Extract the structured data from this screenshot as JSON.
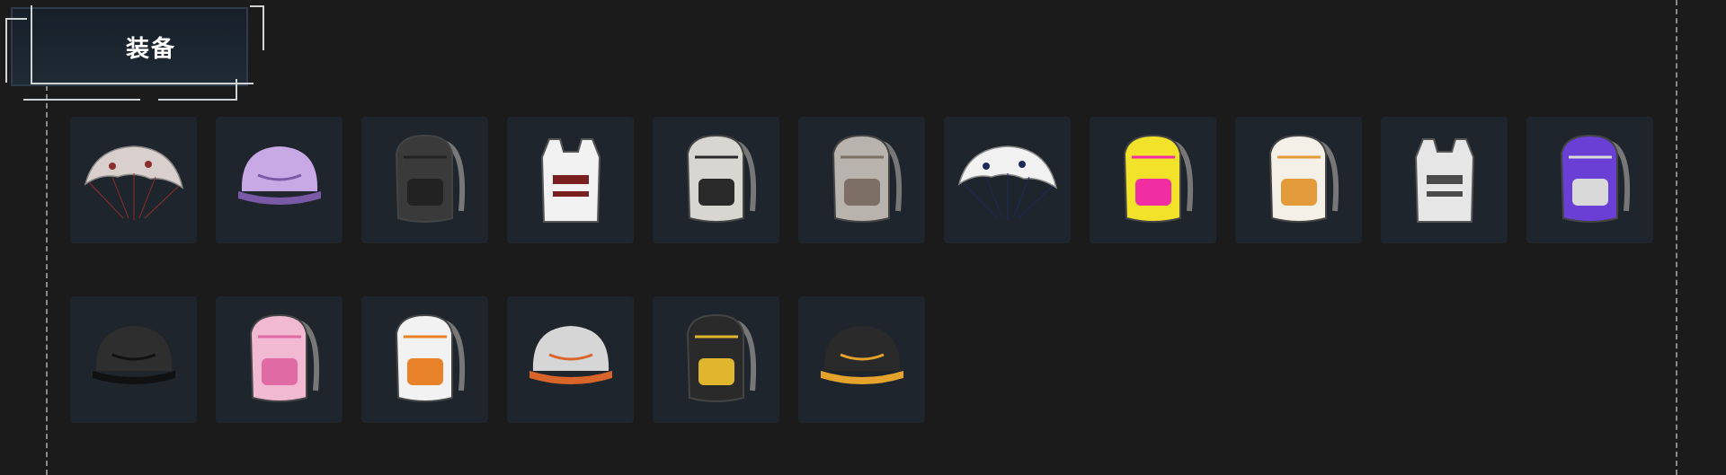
{
  "section": {
    "title": "装备"
  },
  "items": [
    {
      "name": "parachute-icon",
      "colors": [
        "#d9cfcc",
        "#8b2e2e"
      ]
    },
    {
      "name": "helmet-icon",
      "colors": [
        "#c9a8e6",
        "#7a5aa6"
      ]
    },
    {
      "name": "backpack-icon",
      "colors": [
        "#3a3a3a",
        "#222222"
      ]
    },
    {
      "name": "vest-icon",
      "colors": [
        "#f2f2f2",
        "#7a1f1f"
      ]
    },
    {
      "name": "backpack-icon",
      "colors": [
        "#d8d6d0",
        "#2a2a2a"
      ]
    },
    {
      "name": "backpack-icon",
      "colors": [
        "#b8b3ad",
        "#7d6f66"
      ]
    },
    {
      "name": "parachute-icon",
      "colors": [
        "#f2f2f2",
        "#1d2a5a"
      ]
    },
    {
      "name": "backpack-icon",
      "colors": [
        "#f3e22a",
        "#f02da2"
      ]
    },
    {
      "name": "backpack-icon",
      "colors": [
        "#f4f0e8",
        "#e39a3a"
      ]
    },
    {
      "name": "vest-icon",
      "colors": [
        "#e6e6e6",
        "#4a4a4a"
      ]
    },
    {
      "name": "backpack-icon",
      "colors": [
        "#6a3fd6",
        "#d9d9d9"
      ]
    },
    {
      "name": "helmet-icon",
      "colors": [
        "#2e2e2e",
        "#111111"
      ]
    },
    {
      "name": "backpack-icon",
      "colors": [
        "#f2b9d3",
        "#e06aa3"
      ]
    },
    {
      "name": "backpack-icon",
      "colors": [
        "#f2f2f2",
        "#e8822a"
      ]
    },
    {
      "name": "helmet-icon",
      "colors": [
        "#d6d6d6",
        "#d9652a"
      ]
    },
    {
      "name": "backpack-icon",
      "colors": [
        "#2a2a2a",
        "#e0b62e"
      ]
    },
    {
      "name": "helmet-icon",
      "colors": [
        "#2a2a2a",
        "#e3a32c"
      ]
    }
  ]
}
